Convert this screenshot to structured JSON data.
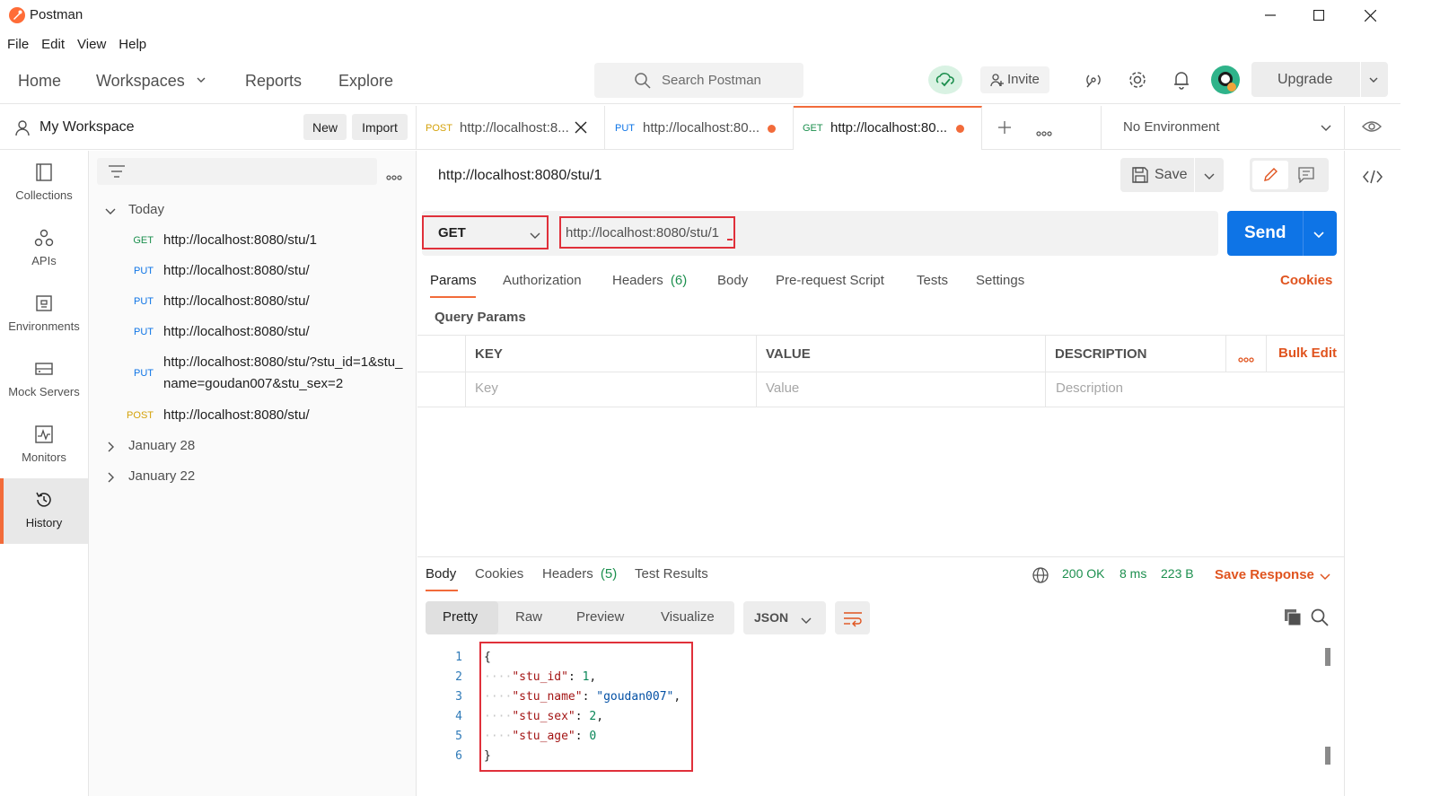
{
  "window": {
    "title": "Postman"
  },
  "menu": [
    "File",
    "Edit",
    "View",
    "Help"
  ],
  "nav": {
    "home": "Home",
    "workspaces": "Workspaces",
    "reports": "Reports",
    "explore": "Explore",
    "search_placeholder": "Search Postman",
    "invite": "Invite",
    "upgrade": "Upgrade"
  },
  "workspace": {
    "title": "My Workspace",
    "new_label": "New",
    "import_label": "Import"
  },
  "sidebar": {
    "items": [
      {
        "label": "Collections",
        "icon": "collections-icon"
      },
      {
        "label": "APIs",
        "icon": "apis-icon"
      },
      {
        "label": "Environments",
        "icon": "environments-icon"
      },
      {
        "label": "Mock Servers",
        "icon": "mock-servers-icon"
      },
      {
        "label": "Monitors",
        "icon": "monitors-icon"
      },
      {
        "label": "History",
        "icon": "history-icon"
      }
    ]
  },
  "history": {
    "today_label": "Today",
    "today": [
      {
        "method": "GET",
        "url": "http://localhost:8080/stu/1"
      },
      {
        "method": "PUT",
        "url": "http://localhost:8080/stu/"
      },
      {
        "method": "PUT",
        "url": "http://localhost:8080/stu/"
      },
      {
        "method": "PUT",
        "url": "http://localhost:8080/stu/"
      },
      {
        "method": "PUT",
        "url": "http://localhost:8080/stu/?stu_id=1&stu_name=goudan007&stu_sex=2"
      },
      {
        "method": "POST",
        "url": "http://localhost:8080/stu/"
      }
    ],
    "groups": [
      "January 28",
      "January 22"
    ]
  },
  "tabs": [
    {
      "method": "POST",
      "url": "http://localhost:8..."
    },
    {
      "method": "PUT",
      "url": "http://localhost:80..."
    },
    {
      "method": "GET",
      "url": "http://localhost:80..."
    }
  ],
  "environment": "No Environment",
  "request": {
    "title": "http://localhost:8080/stu/1",
    "save_label": "Save",
    "method": "GET",
    "url": "http://localhost:8080/stu/1",
    "send_label": "Send",
    "subtabs": {
      "params": "Params",
      "authorization": "Authorization",
      "headers": "Headers",
      "headers_count": "(6)",
      "body": "Body",
      "prerequest": "Pre-request Script",
      "tests": "Tests",
      "settings": "Settings"
    },
    "cookies_label": "Cookies",
    "query_title": "Query Params",
    "table": {
      "headers": [
        "KEY",
        "VALUE",
        "DESCRIPTION"
      ],
      "placeholders": [
        "Key",
        "Value",
        "Description"
      ],
      "bulk_edit": "Bulk Edit"
    }
  },
  "response": {
    "tabs": {
      "body": "Body",
      "cookies": "Cookies",
      "headers": "Headers",
      "headers_count": "(5)",
      "test_results": "Test Results"
    },
    "status": "200 OK",
    "time": "8 ms",
    "size": "223 B",
    "save_response": "Save Response",
    "views": [
      "Pretty",
      "Raw",
      "Preview",
      "Visualize"
    ],
    "format": "JSON",
    "lines": [
      "1",
      "2",
      "3",
      "4",
      "5",
      "6"
    ],
    "json": {
      "k1": "\"stu_id\"",
      "v1": "1",
      "k2": "\"stu_name\"",
      "v2": "\"goudan007\"",
      "k3": "\"stu_sex\"",
      "v3": "2",
      "k4": "\"stu_age\"",
      "v4": "0"
    }
  },
  "colors": {
    "accent": "#f26b3a",
    "send": "#0e74e6",
    "highlight": "#e0303a",
    "status_ok": "#1c8f4e"
  }
}
